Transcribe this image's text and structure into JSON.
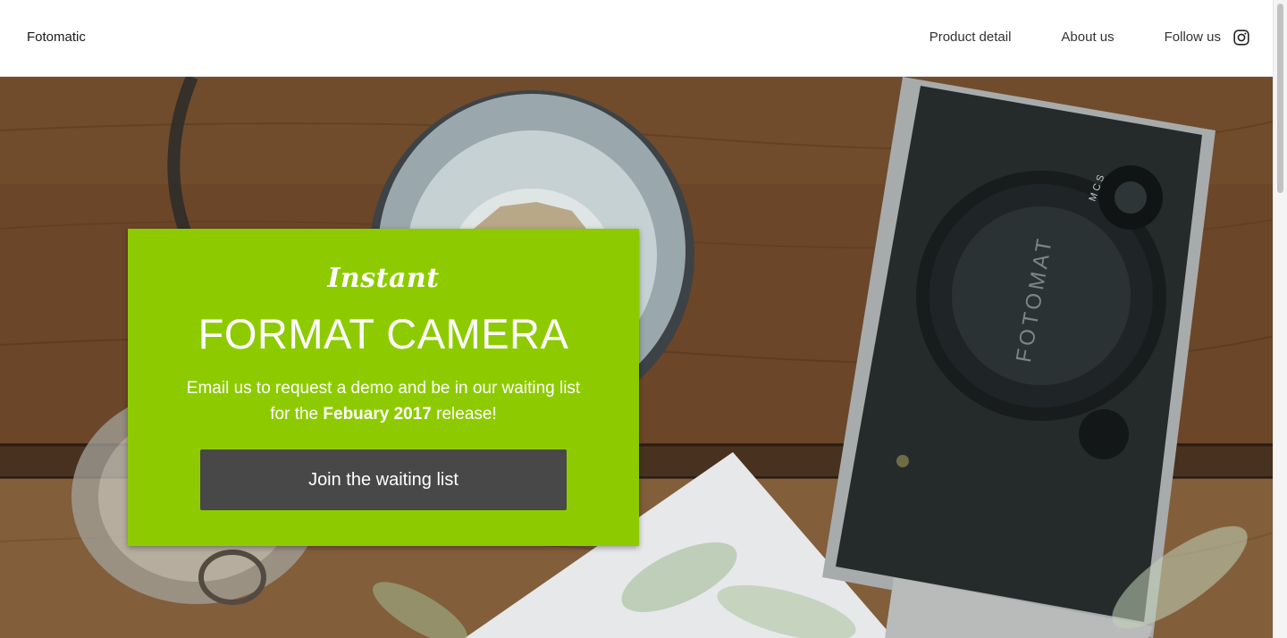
{
  "header": {
    "brand": "Fotomatic",
    "nav": {
      "product_detail": "Product detail",
      "about_us": "About us",
      "follow_us": "Follow us"
    }
  },
  "hero": {
    "camera_brand": "FOTOMAT",
    "dial_letters": "M C S",
    "card": {
      "script_title": "Instant",
      "title": "FORMAT CAMERA",
      "desc_before": "Email us to request a demo and be in our waiting list for the ",
      "desc_highlight": "Febuary 2017",
      "desc_after": " release!",
      "cta_label": "Join the waiting list",
      "background_color": "#8dcb00",
      "button_color": "#484848"
    }
  },
  "icons": {
    "instagram": "instagram-icon"
  }
}
